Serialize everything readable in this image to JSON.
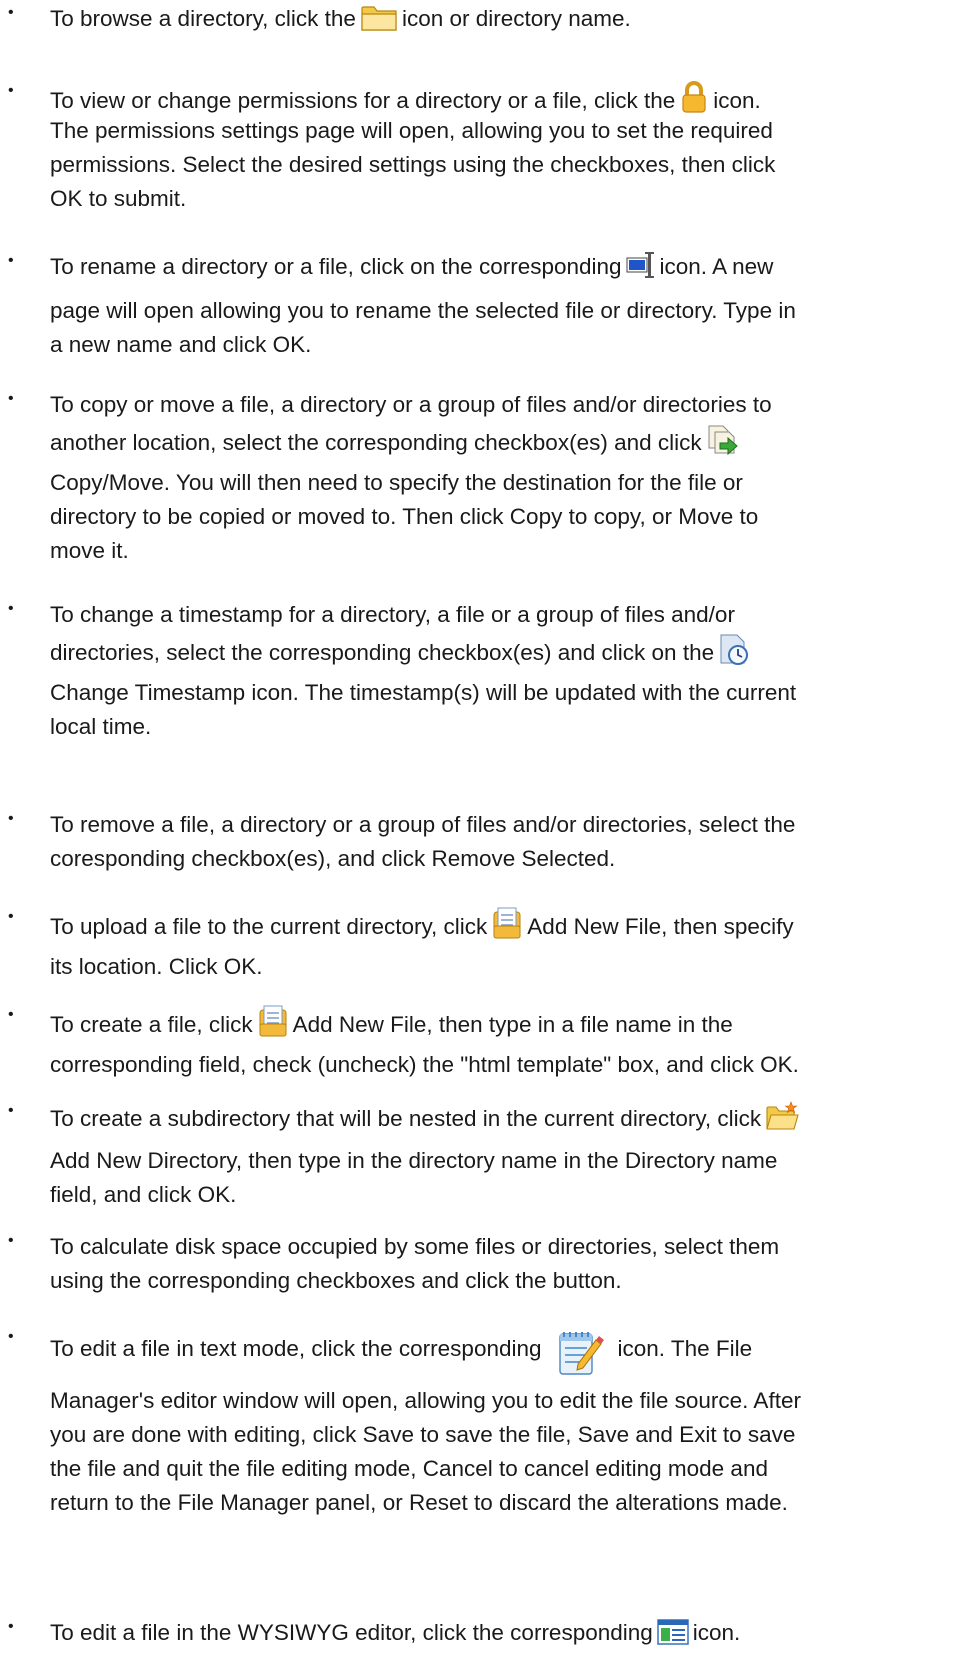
{
  "bullet_glyph": "•",
  "steps": [
    {
      "icon": "folder-icon",
      "lines": [
        [
          "To browse a directory, click the",
          "icon or directory name."
        ]
      ]
    },
    {
      "icon": "lock-icon",
      "lines": [
        [
          "To view or change permissions for a directory or a file, click the",
          "icon."
        ],
        [
          "The permissions settings page will open, allowing you to set the required"
        ],
        [
          "permissions. Select the desired settings using the checkboxes, then click"
        ],
        [
          "OK to submit."
        ]
      ]
    },
    {
      "icon": "rename-icon",
      "lines": [
        [
          "To rename a directory or a file, click on the corresponding",
          "icon. A new"
        ],
        [
          "page will open allowing you to rename the selected file or directory. Type in"
        ],
        [
          "a new name and click OK."
        ]
      ]
    },
    {
      "icon": "copy-move-icon",
      "lines": [
        [
          "To copy or move a file, a directory or a group of files and/or directories to"
        ],
        [
          "another location, select the corresponding checkbox(es) and click",
          ""
        ],
        [
          "Copy/Move. You will then need to specify the destination for the file or"
        ],
        [
          "directory to be copied or moved to. Then click Copy to copy, or Move to"
        ],
        [
          "move it."
        ]
      ]
    },
    {
      "icon": "timestamp-icon",
      "lines": [
        [
          "To change a timestamp for a directory, a file or a group of files and/or"
        ],
        [
          "directories, select the corresponding checkbox(es) and click on the",
          ""
        ],
        [
          "Change Timestamp icon. The timestamp(s) will be updated with the current"
        ],
        [
          "local time."
        ]
      ]
    },
    {
      "icon": null,
      "lines": [
        [
          "To remove a file, a directory or a group of files and/or directories, select the"
        ],
        [
          "coresponding checkbox(es), and click Remove Selected."
        ]
      ]
    },
    {
      "icon": "add-file-icon",
      "lines": [
        [
          "To upload a file to the current directory, click",
          "Add New File, then specify"
        ],
        [
          "its location. Click OK."
        ]
      ]
    },
    {
      "icon": "add-file-icon",
      "lines": [
        [
          "To create a file, click",
          "Add New File, then type in a file name in the"
        ],
        [
          "corresponding field, check (uncheck) the \"html template\" box, and click OK."
        ]
      ]
    },
    {
      "icon": "add-directory-icon",
      "lines": [
        [
          "To create a subdirectory that will be nested in the current directory, click",
          ""
        ],
        [
          "Add New Directory, then type in the directory name in the Directory name"
        ],
        [
          "field, and click OK."
        ]
      ]
    },
    {
      "icon": null,
      "lines": [
        [
          "To calculate disk space occupied by some files or directories, select them"
        ],
        [
          "using the corresponding checkboxes and click the button."
        ]
      ]
    },
    {
      "icon": "text-editor-icon",
      "lines": [
        [
          "To edit a file in text mode, click the corresponding",
          "icon. The File"
        ],
        [
          "Manager's editor window will open, allowing you to edit the file source. After"
        ],
        [
          "you are done with editing, click Save to save the file, Save and Exit to save"
        ],
        [
          "the file and quit the file editing mode, Cancel to cancel editing mode and"
        ],
        [
          "return to the File Manager panel, or Reset to discard the alterations made."
        ]
      ]
    },
    {
      "icon": "wysiwyg-editor-icon",
      "lines": [
        [
          "To edit a file in the WYSIWYG editor, click the corresponding",
          "icon."
        ]
      ]
    }
  ]
}
